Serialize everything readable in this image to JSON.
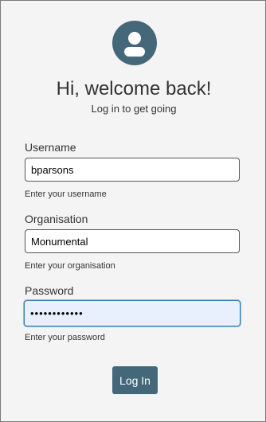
{
  "header": {
    "title": "Hi, welcome back!",
    "subtitle": "Log in to get going"
  },
  "form": {
    "username": {
      "label": "Username",
      "value": "bparsons",
      "hint": "Enter your username"
    },
    "organisation": {
      "label": "Organisation",
      "value": "Monumental",
      "hint": "Enter your organisation"
    },
    "password": {
      "label": "Password",
      "value": "••••••••••••",
      "hint": "Enter your password"
    },
    "submit_label": "Log In"
  },
  "icons": {
    "avatar": "user-avatar-icon"
  },
  "colors": {
    "accent": "#44687a",
    "background": "#f4f4f4",
    "focused_field_bg": "#e8f0fe",
    "focused_field_border": "#3d7ca8"
  }
}
